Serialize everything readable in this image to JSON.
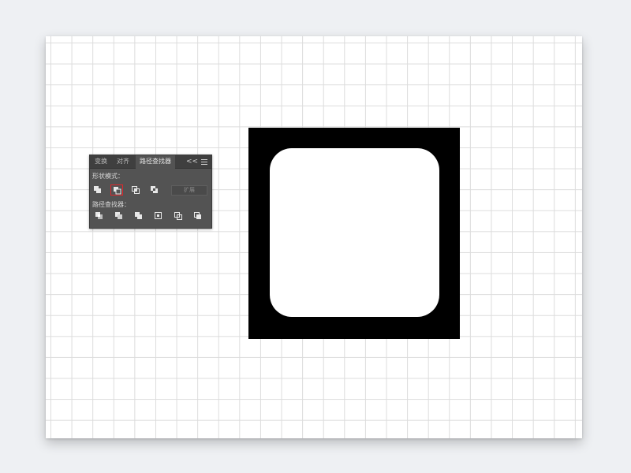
{
  "panel": {
    "tabs": [
      {
        "label": "变换",
        "active": false
      },
      {
        "label": "对齐",
        "active": false
      },
      {
        "label": "路径查找器",
        "active": true
      }
    ],
    "collapse_glyph": "<<",
    "shape_modes_label": "形状模式：",
    "pathfinders_label": "路径查找器：",
    "expand_label": "扩展",
    "shape_mode_buttons": [
      "unite-icon",
      "minus-front-icon",
      "intersect-icon",
      "exclude-icon"
    ],
    "pathfinder_buttons": [
      "divide-icon",
      "trim-icon",
      "merge-icon",
      "crop-icon",
      "outline-icon",
      "minus-back-icon"
    ],
    "selected_button": "minus-front-icon",
    "highlight_color": "#e0262b"
  },
  "canvas": {
    "shape_fill": "#000000",
    "inner_fill": "#ffffff"
  }
}
